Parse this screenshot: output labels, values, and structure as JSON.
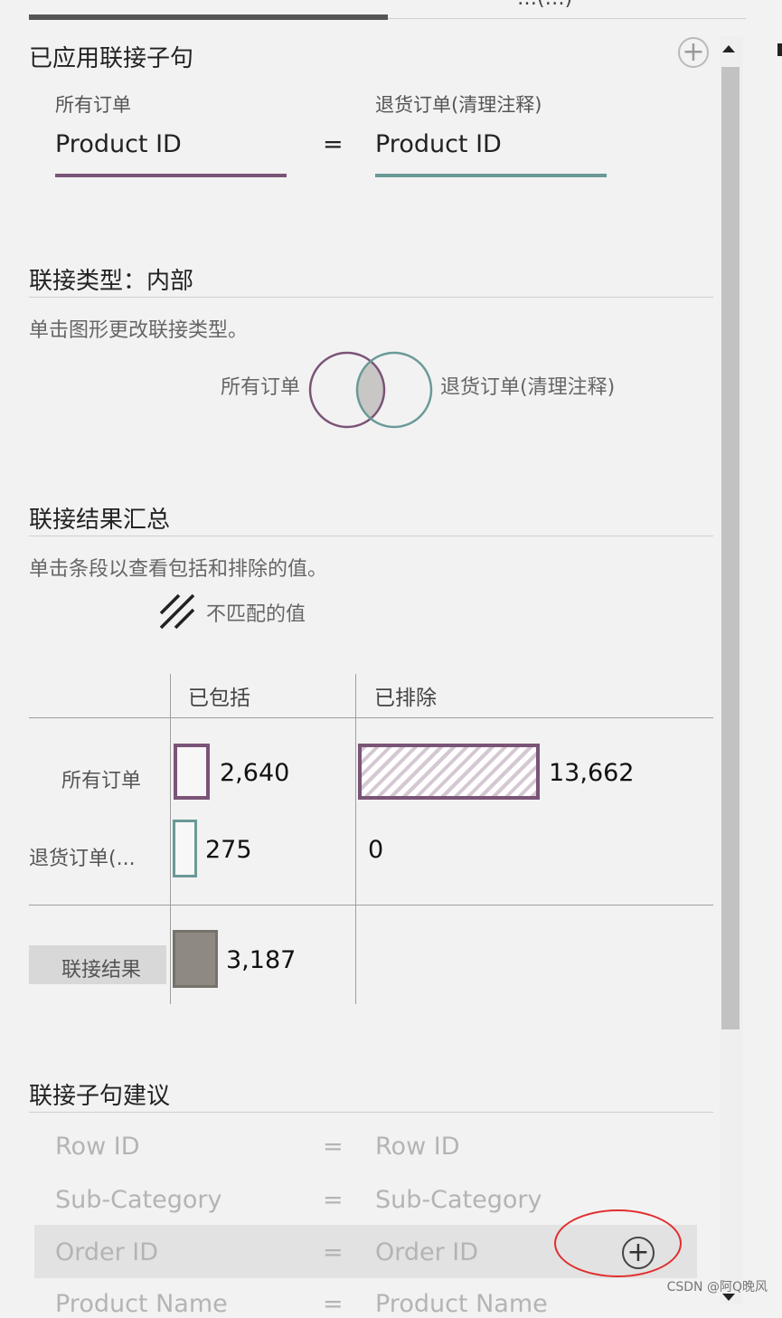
{
  "header": {
    "partial_tab_text": "…(…)"
  },
  "applied_clause": {
    "title": "已应用联接子句",
    "left_table": "所有订单",
    "right_table": "退货订单(清理注释)",
    "left_field": "Product ID",
    "operator": "=",
    "right_field": "Product ID",
    "add_icon": "plus-circle-icon"
  },
  "join_type": {
    "title": "联接类型：内部",
    "hint": "单击图形更改联接类型。",
    "left_label": "所有订单",
    "right_label": "退货订单(清理注释)"
  },
  "summary": {
    "title": "联接结果汇总",
    "hint": "单击条段以查看包括和排除的值。",
    "legend_label": "不匹配的值",
    "col_included": "已包括",
    "col_excluded": "已排除",
    "rows": [
      {
        "label": "所有订单",
        "included": "2,640",
        "excluded": "13,662"
      },
      {
        "label": "退货订单(...",
        "included": "275",
        "excluded": "0"
      }
    ],
    "result_label": "联接结果",
    "result_value": "3,187"
  },
  "suggestions": {
    "title": "联接子句建议",
    "items": [
      {
        "left": "Row ID",
        "op": "=",
        "right": "Row ID"
      },
      {
        "left": "Sub-Category",
        "op": "=",
        "right": "Sub-Category"
      },
      {
        "left": "Order ID",
        "op": "=",
        "right": "Order ID"
      },
      {
        "left": "Product Name",
        "op": "=",
        "right": "Product Name"
      }
    ]
  },
  "watermark": "CSDN @阿Q晚风",
  "colors": {
    "left_table": "#7a5477",
    "right_table": "#6a9a97",
    "result": "#8e8a83",
    "highlight_circle": "#e22d2d"
  }
}
